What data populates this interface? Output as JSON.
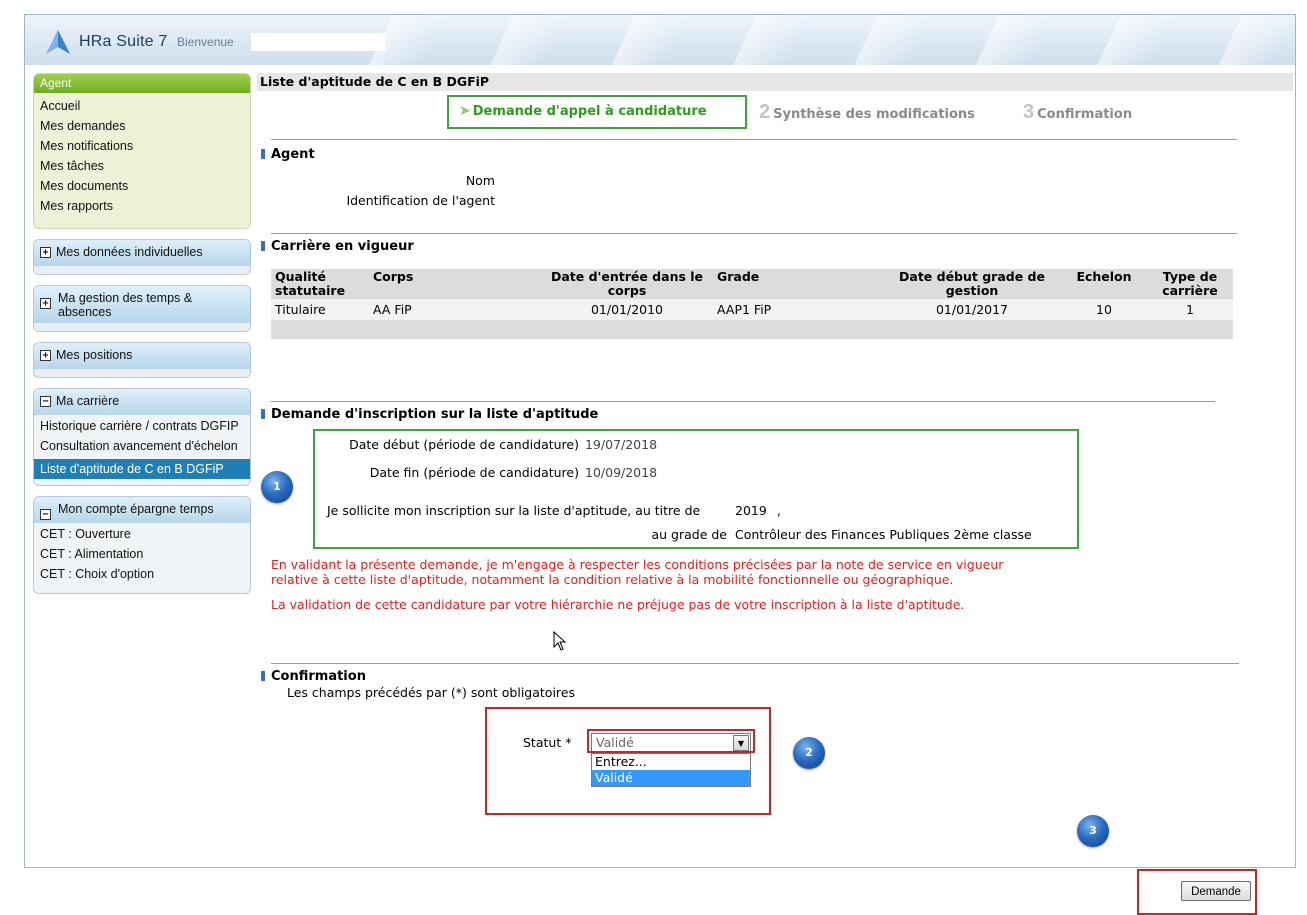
{
  "app": {
    "title": "HRa Suite 7",
    "welcome": "Bienvenue"
  },
  "sidebar": {
    "agent_header": "Agent",
    "agent_links": [
      "Accueil",
      "Mes demandes",
      "Mes notifications",
      "Mes tâches",
      "Mes documents",
      "Mes rapports"
    ],
    "panels": {
      "donnees": "Mes données individuelles",
      "temps": "Ma gestion des temps & absences",
      "positions": "Mes positions",
      "carriere": "Ma carrière",
      "cet": "Mon compte épargne temps"
    },
    "carriere_links": [
      "Historique carrière / contrats DGFIP",
      "Consultation avancement d'échelon",
      "Liste d'aptitude de C en B DGFiP"
    ],
    "cet_links": [
      "CET : Ouverture",
      "CET : Alimentation",
      "CET : Choix d'option"
    ]
  },
  "main": {
    "title": "Liste d'aptitude de C en B DGFiP",
    "steps": {
      "step1": "Demande d'appel à candidature",
      "step2_num": "2",
      "step2": "Synthèse des modifications",
      "step3_num": "3",
      "step3": "Confirmation"
    },
    "agent": {
      "section": "Agent",
      "nom_label": "Nom",
      "id_label": "Identification de l'agent"
    },
    "carriere": {
      "section": "Carrière en vigueur",
      "headers": [
        "Qualité statutaire",
        "Corps",
        "Date d'entrée dans le corps",
        "Grade",
        "Date début grade de gestion",
        "Echelon",
        "Type de carrière"
      ],
      "row": [
        "Titulaire",
        "AA FiP",
        "01/01/2010",
        "AAP1 FiP",
        "01/01/2017",
        "10",
        "1"
      ]
    },
    "inscription": {
      "section": "Demande d'inscription sur la liste d'aptitude",
      "date_debut_label": "Date début (période de candidature)",
      "date_debut": "19/07/2018",
      "date_fin_label": "Date fin (période de candidature)",
      "date_fin": "10/09/2018",
      "sollicite_text": "Je sollicite mon inscription sur la liste d'aptitude, au titre de",
      "annee": "2019",
      "comma": ",",
      "grade_label": "au grade de",
      "grade": "Contrôleur des Finances Publiques 2ème classe"
    },
    "warning1_line1": "En validant la présente demande, je m'engage à respecter les conditions précisées par la note de service en vigueur",
    "warning1_line2": "relative à cette liste d'aptitude, notamment la condition relative à la mobilité fonctionnelle ou géographique.",
    "warning2": "La validation de cette candidature par votre hiérarchie ne préjuge pas de votre inscription à la liste d'aptitude.",
    "confirmation": {
      "section": "Confirmation",
      "required_note": "Les champs précédés par (*) sont obligatoires",
      "statut_label": "Statut *",
      "statut_value": "Validé",
      "options": [
        "Entrez...",
        "Validé"
      ]
    },
    "submit_label": "Demande",
    "badges": [
      "1",
      "2",
      "3"
    ]
  },
  "colors": {
    "accent_green": "#3fa33f",
    "highlight_red": "#c2272d",
    "warning_text": "#e02020",
    "active_nav": "#1f7fb5"
  }
}
